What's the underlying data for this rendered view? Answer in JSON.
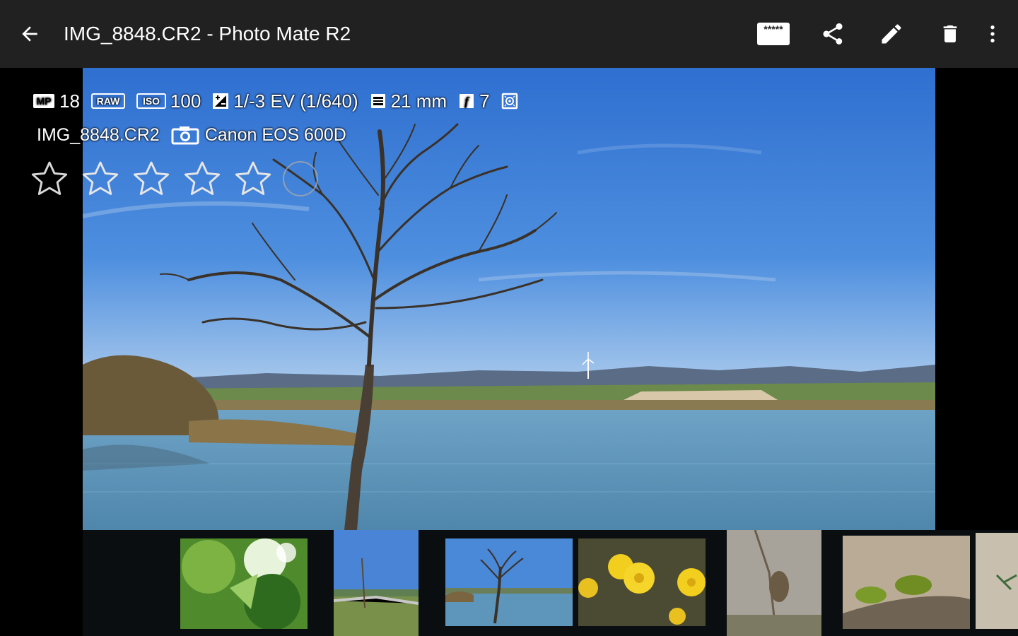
{
  "window": {
    "title": "IMG_8848.CR2 - Photo Mate R2"
  },
  "toolbar": {
    "back_icon": "arrow-left-icon",
    "rating_chip_text": "*****",
    "actions": [
      "rating-icon",
      "share-icon",
      "edit-icon",
      "delete-icon",
      "more-vert-icon"
    ]
  },
  "exif": {
    "megapixels": "18",
    "format_badge": "RAW",
    "iso_badge": "ISO",
    "iso": "100",
    "exposure": "1/-3 EV (1/640)",
    "focal_length": "21 mm",
    "aperture_badge": "f",
    "aperture": "7",
    "mp_badge": "MP"
  },
  "file": {
    "name": "IMG_8848.CR2",
    "camera": "Canon EOS 600D"
  },
  "rating": {
    "stars": 0,
    "max": 5
  },
  "filmstrip": {
    "count": 8,
    "selected": 3
  },
  "colors": {
    "appbar": "#212121",
    "background": "#000000",
    "text": "#ffffff",
    "sky": "#3d7fd6",
    "water": "#5b90b3"
  }
}
